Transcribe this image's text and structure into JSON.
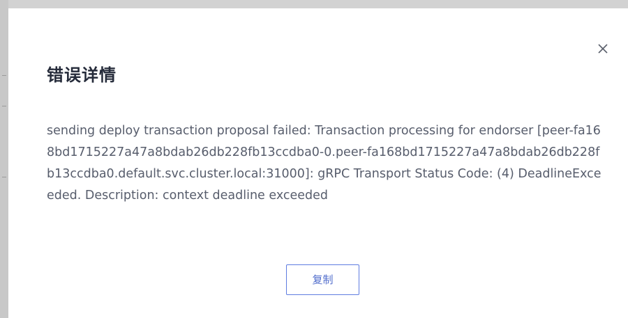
{
  "dialog": {
    "title": "错误详情",
    "close_icon": "close-icon",
    "message": "sending deploy transaction proposal failed: Transaction processing for endorser [peer-fa168bd1715227a47a8bdab26db228fb13ccdba0-0.peer-fa168bd1715227a47a8bdab26db228fb13ccdba0.default.svc.cluster.local:31000]: gRPC Transport Status Code: (4) DeadlineExceeded. Description: context deadline exceeded",
    "copy_label": "复制"
  },
  "colors": {
    "overlay": "#d2d2d2",
    "dialog_bg": "#ffffff",
    "title": "#252b3a",
    "text": "#575d6c",
    "accent": "#5e7ce0"
  }
}
